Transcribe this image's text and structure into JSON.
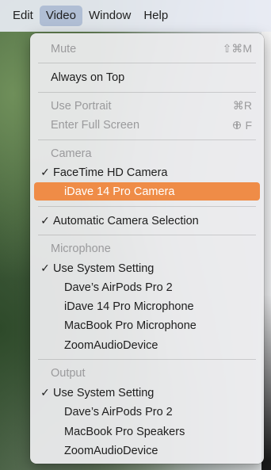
{
  "menubar": {
    "items": [
      "Edit",
      "Video",
      "Window",
      "Help"
    ],
    "active": "Video"
  },
  "menu": {
    "mute": {
      "label": "Mute",
      "shortcut": "⇧⌘M"
    },
    "always_on_top": {
      "label": "Always on Top"
    },
    "use_portrait": {
      "label": "Use Portrait",
      "shortcut": "⌘R"
    },
    "enter_full_screen": {
      "label": "Enter Full Screen",
      "shortcut": "F"
    },
    "camera": {
      "header": "Camera",
      "items": [
        "FaceTime HD Camera",
        "iDave 14 Pro Camera"
      ],
      "checked": "FaceTime HD Camera",
      "highlighted": "iDave 14 Pro Camera"
    },
    "automatic_camera_selection": {
      "label": "Automatic Camera Selection",
      "checked": true
    },
    "microphone": {
      "header": "Microphone",
      "items": [
        "Use System Setting",
        "Dave’s AirPods Pro 2",
        "iDave 14 Pro Microphone",
        "MacBook Pro Microphone",
        "ZoomAudioDevice"
      ],
      "checked": "Use System Setting"
    },
    "output": {
      "header": "Output",
      "items": [
        "Use System Setting",
        "Dave’s AirPods Pro 2",
        "MacBook Pro Speakers",
        "ZoomAudioDevice"
      ],
      "checked": "Use System Setting"
    },
    "check_glyph": "✓"
  },
  "colors": {
    "highlight": "#ef8c47",
    "disabled_text": "#9a9a9c"
  }
}
